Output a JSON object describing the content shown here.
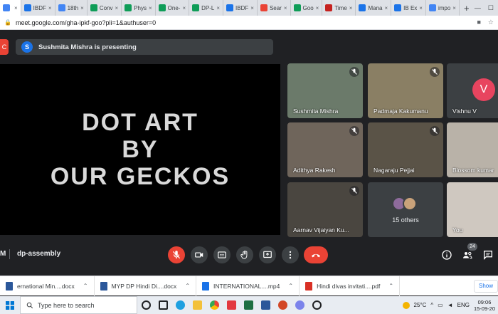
{
  "browser": {
    "tabs": [
      {
        "label": "",
        "color": "#4285f4",
        "active": true
      },
      {
        "label": "IBDF",
        "color": "#1a73e8"
      },
      {
        "label": "18th",
        "color": "#4285f4"
      },
      {
        "label": "Conv",
        "color": "#0f9d58"
      },
      {
        "label": "Phys",
        "color": "#0f9d58"
      },
      {
        "label": "One-",
        "color": "#0f9d58"
      },
      {
        "label": "DP-L",
        "color": "#0f9d58"
      },
      {
        "label": "IBDF",
        "color": "#1a73e8"
      },
      {
        "label": "Sear",
        "color": "#ea4335"
      },
      {
        "label": "Goo",
        "color": "#0f9d58"
      },
      {
        "label": "Time",
        "color": "#c5221f"
      },
      {
        "label": "Mana",
        "color": "#1a73e8"
      },
      {
        "label": "IB Ex",
        "color": "#1a73e8"
      },
      {
        "label": "impo",
        "color": "#4285f4"
      }
    ],
    "new_tab": "+",
    "url": "meet.google.com/gha-ipkf-goo?pli=1&authuser=0"
  },
  "meet": {
    "presenter_initial": "S",
    "presenting_text": "Sushmita Mishra is presenting",
    "logo_letter": "C",
    "slide_lines": [
      "DOT ART",
      "BY",
      "OUR GECKOS"
    ],
    "participants": [
      {
        "name": "Sushmita Mishra",
        "bg": "#6b7a6a",
        "muted": true
      },
      {
        "name": "Padmaja Kakumanu",
        "bg": "#8a7f64",
        "muted": true
      },
      {
        "name": "Vishnu V",
        "bg": "#3c4043",
        "muted": false,
        "initial": "V"
      },
      {
        "name": "Adithya Rakesh",
        "bg": "#6f655b",
        "muted": true
      },
      {
        "name": "Nagaraju Pejjai",
        "bg": "#5a5347",
        "muted": true
      },
      {
        "name": "Blossom kumar",
        "bg": "#b9b2a8",
        "muted": true
      },
      {
        "name": "Aarnav Vijaiyan Ku...",
        "bg": "#4a4640",
        "muted": true
      },
      {
        "name": "",
        "bg": "#3c4043",
        "others": "15 others"
      },
      {
        "name": "You",
        "bg": "#cfc8c0",
        "muted": false
      }
    ],
    "meeting_time": "M",
    "meeting_code": "dp-assembly",
    "people_count": "24"
  },
  "downloads": {
    "items": [
      {
        "label": "ernational Min....docx",
        "color": "#2b579a"
      },
      {
        "label": "MYP DP Hindi Di....docx",
        "color": "#2b579a"
      },
      {
        "label": "INTERNATIONAL....mp4",
        "color": "#1a73e8"
      },
      {
        "label": "Hindi divas invitati....pdf",
        "color": "#d93025"
      }
    ],
    "show_all": "Show"
  },
  "taskbar": {
    "search_placeholder": "Type here to search",
    "temperature": "25°C",
    "lang": "ENG",
    "time": "09:06",
    "date": "15-09-20"
  }
}
